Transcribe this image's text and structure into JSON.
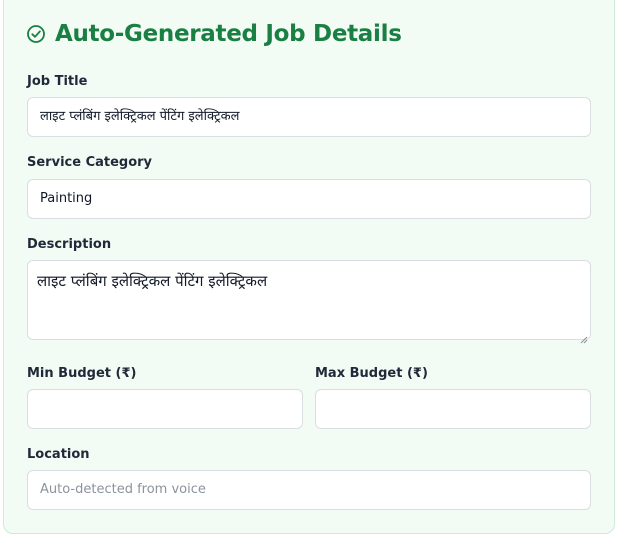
{
  "section": {
    "title": "Auto-Generated Job Details",
    "icon": "check-circle-icon",
    "accent_color": "#1a7f42"
  },
  "fields": {
    "job_title": {
      "label": "Job Title",
      "value": "लाइट प्लंबिंग इलेक्ट्रिकल पेंटिंग इलेक्ट्रिकल"
    },
    "service_category": {
      "label": "Service Category",
      "value": "Painting"
    },
    "description": {
      "label": "Description",
      "value": "लाइट प्लंबिंग इलेक्ट्रिकल पेंटिंग इलेक्ट्रिकल"
    },
    "min_budget": {
      "label": "Min Budget (₹)",
      "value": ""
    },
    "max_budget": {
      "label": "Max Budget (₹)",
      "value": ""
    },
    "location": {
      "label": "Location",
      "value": "",
      "placeholder": "Auto-detected from voice"
    }
  }
}
